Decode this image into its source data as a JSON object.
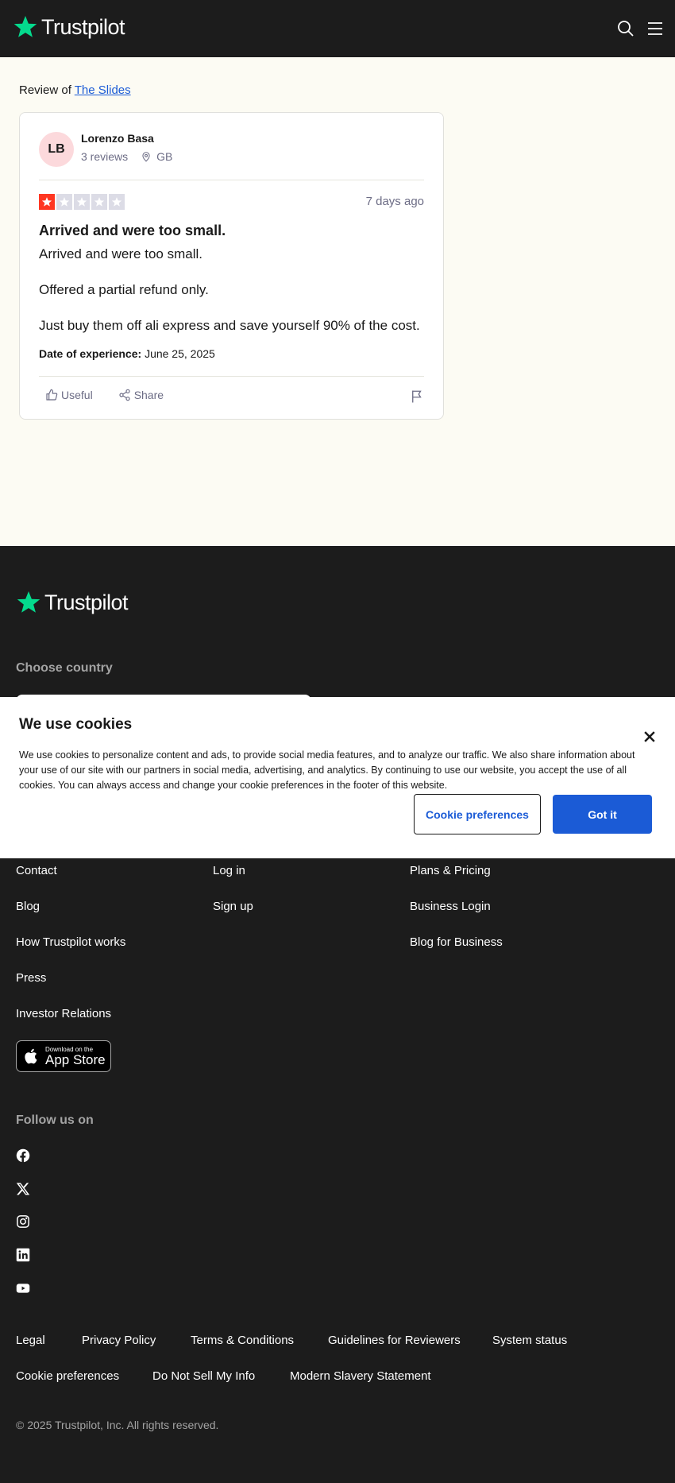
{
  "brand": {
    "name": "Trustpilot",
    "accent": "#04da8d",
    "link_color": "#1b5bd6"
  },
  "header": {
    "icons": [
      "search-icon",
      "menu-icon"
    ]
  },
  "review_page": {
    "review_of_prefix": "Review of",
    "company_name": "The Slides",
    "reviewer": {
      "initials": "LB",
      "name": "Lorenzo Basa",
      "reviews": "3 reviews",
      "country": "GB"
    },
    "rating": 1,
    "rating_max": 5,
    "date_ago": "7 days ago",
    "title": "Arrived and were too small.",
    "body": [
      "Arrived and were too small.",
      "Offered a partial refund only.",
      "Just buy them off ali express and save yourself 90% of the cost."
    ],
    "experience_label": "Date of experience:",
    "experience_date": "June 25, 2025",
    "actions": {
      "useful": "Useful",
      "share": "Share"
    }
  },
  "footer": {
    "choose_country": "Choose country",
    "col1": [
      "Contact",
      "Blog",
      "How Trustpilot works",
      "Press",
      "Investor Relations"
    ],
    "col2": [
      "Log in",
      "Sign up"
    ],
    "col3": [
      "Plans & Pricing",
      "Business Login",
      "Blog for Business"
    ],
    "appstore": {
      "small": "Download on the",
      "big": "App Store"
    },
    "follow_us": "Follow us on",
    "social": [
      "facebook-icon",
      "x-icon",
      "instagram-icon",
      "linkedin-icon",
      "youtube-icon"
    ],
    "legal_row1": [
      "Legal",
      "Privacy Policy",
      "Terms & Conditions",
      "Guidelines for Reviewers",
      "System status"
    ],
    "legal_row2": [
      "Cookie preferences",
      "Do Not Sell My Info",
      "Modern Slavery Statement"
    ],
    "copyright": "© 2025 Trustpilot, Inc. All rights reserved."
  },
  "cookie_banner": {
    "title": "We use cookies",
    "text": "We use cookies to personalize content and ads, to provide social media features, and to analyze our traffic. We also share information about your use of our site with our partners in social media, advertising, and analytics. By continuing to use our website, you accept the use of all cookies. You can always access and change your cookie preferences in the footer of this website.",
    "preferences_button": "Cookie preferences",
    "accept_button": "Got it"
  }
}
